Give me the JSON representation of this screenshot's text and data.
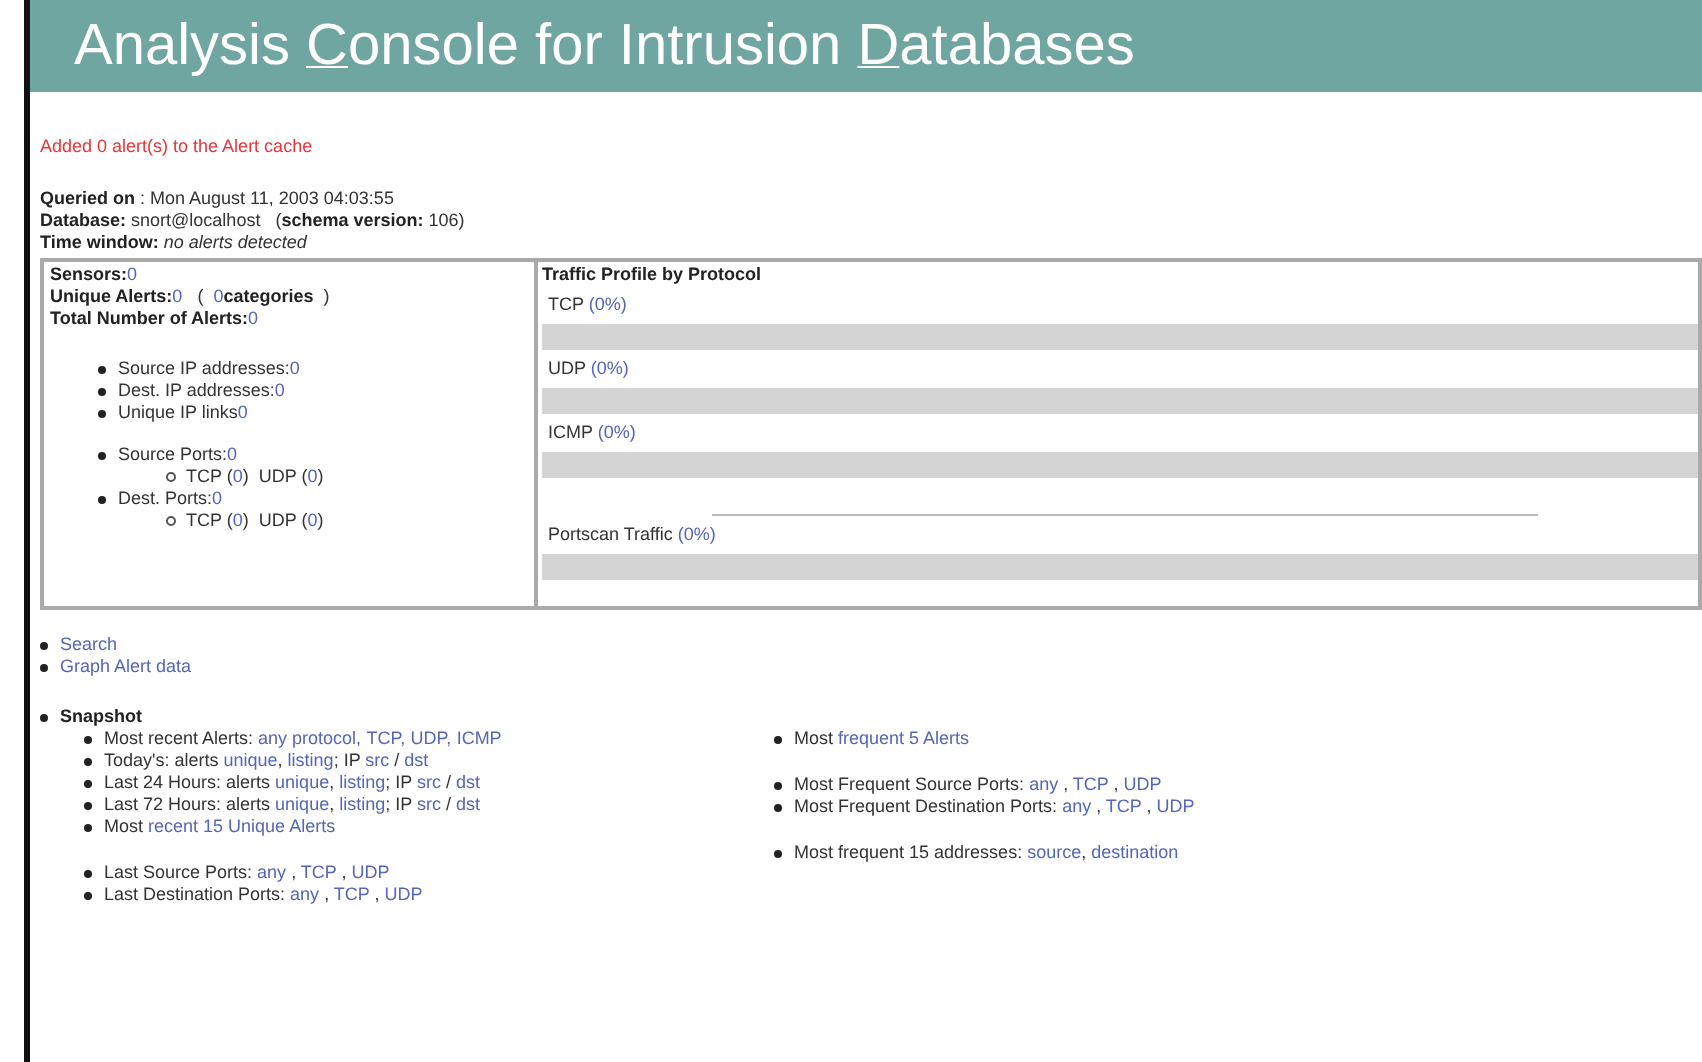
{
  "title": [
    {
      "text": "Analysis ",
      "underline": false
    },
    {
      "text": "C",
      "underline": true
    },
    {
      "text": "onsole for Intrusion ",
      "underline": false
    },
    {
      "text": "D",
      "underline": true
    },
    {
      "text": "atabases",
      "underline": false
    }
  ],
  "alert_message": "Added 0 alert(s) to the Alert cache",
  "query_info": [
    [
      {
        "kind": "bold",
        "text": "Queried on"
      },
      {
        "kind": "text",
        "text": " : Mon August 11, 2003 04:03:55"
      }
    ],
    [
      {
        "kind": "bold",
        "text": "Database:"
      },
      {
        "kind": "text",
        "text": " snort@localhost   ("
      },
      {
        "kind": "bold",
        "text": "schema version:"
      },
      {
        "kind": "text",
        "text": " 106)"
      }
    ],
    [
      {
        "kind": "bold",
        "text": "Time window:"
      },
      {
        "kind": "italic",
        "text": " no alerts detected"
      }
    ]
  ],
  "summary": [
    [
      {
        "kind": "bold",
        "text": "Sensors:"
      },
      {
        "kind": "link",
        "text": "0"
      }
    ],
    [
      {
        "kind": "bold",
        "text": "Unique Alerts:"
      },
      {
        "kind": "link",
        "text": "0"
      },
      {
        "kind": "text",
        "text": "   (  "
      },
      {
        "kind": "link",
        "text": "0"
      },
      {
        "kind": "bold",
        "text": "categories"
      },
      {
        "kind": "text",
        "text": "  )"
      }
    ],
    [
      {
        "kind": "bold",
        "text": "Total Number of Alerts:"
      },
      {
        "kind": "link",
        "text": "0"
      }
    ]
  ],
  "summary_lists": [
    [
      {
        "segments": [
          {
            "kind": "text",
            "text": "Source IP addresses:"
          },
          {
            "kind": "link",
            "text": "0"
          }
        ]
      },
      {
        "segments": [
          {
            "kind": "text",
            "text": "Dest. IP addresses:"
          },
          {
            "kind": "link",
            "text": "0"
          }
        ]
      },
      {
        "segments": [
          {
            "kind": "text",
            "text": "Unique IP links"
          },
          {
            "kind": "link",
            "text": "0"
          }
        ]
      }
    ],
    [
      {
        "segments": [
          {
            "kind": "text",
            "text": "Source Ports:"
          },
          {
            "kind": "link",
            "text": "0"
          }
        ],
        "children": [
          [
            {
              "kind": "text",
              "text": "TCP ("
            },
            {
              "kind": "link",
              "text": "0"
            },
            {
              "kind": "text",
              "text": ")  UDP ("
            },
            {
              "kind": "link",
              "text": "0"
            },
            {
              "kind": "text",
              "text": ")"
            }
          ]
        ]
      },
      {
        "segments": [
          {
            "kind": "text",
            "text": "Dest. Ports:"
          },
          {
            "kind": "link",
            "text": "0"
          }
        ],
        "children": [
          [
            {
              "kind": "text",
              "text": "TCP ("
            },
            {
              "kind": "link",
              "text": "0"
            },
            {
              "kind": "text",
              "text": ")  UDP ("
            },
            {
              "kind": "link",
              "text": "0"
            },
            {
              "kind": "text",
              "text": ")"
            }
          ]
        ]
      }
    ]
  ],
  "traffic": {
    "heading": "Traffic Profile by Protocol",
    "protocols": [
      {
        "label": "TCP",
        "percent": "(0%)",
        "level": 0
      },
      {
        "label": "UDP",
        "percent": "(0%)",
        "level": 0
      },
      {
        "label": "ICMP",
        "percent": "(0%)",
        "level": 0
      }
    ],
    "portscan": {
      "label": "Portscan Traffic",
      "percent": "(0%)",
      "level": 0
    }
  },
  "links": [
    "Search",
    "Graph Alert data"
  ],
  "snapshot": {
    "label": "Snapshot",
    "left_groups": [
      [
        [
          {
            "kind": "text",
            "text": "Most recent Alerts: "
          },
          {
            "kind": "link",
            "text": "any protocol,"
          },
          {
            "kind": "link",
            "text": "TCP,"
          },
          {
            "kind": "link",
            "text": "UDP,"
          },
          {
            "kind": "link",
            "text": "ICMP"
          }
        ],
        [
          {
            "kind": "text",
            "text": "Today's: alerts "
          },
          {
            "kind": "link",
            "text": "unique"
          },
          {
            "kind": "text",
            "text": ", "
          },
          {
            "kind": "link",
            "text": "listing"
          },
          {
            "kind": "text",
            "text": "; IP "
          },
          {
            "kind": "link",
            "text": "src"
          },
          {
            "kind": "text",
            "text": " / "
          },
          {
            "kind": "link",
            "text": "dst"
          }
        ],
        [
          {
            "kind": "text",
            "text": "Last 24 Hours: alerts "
          },
          {
            "kind": "link",
            "text": "unique"
          },
          {
            "kind": "text",
            "text": ", "
          },
          {
            "kind": "link",
            "text": "listing"
          },
          {
            "kind": "text",
            "text": "; IP "
          },
          {
            "kind": "link",
            "text": "src"
          },
          {
            "kind": "text",
            "text": " / "
          },
          {
            "kind": "link",
            "text": "dst"
          }
        ],
        [
          {
            "kind": "text",
            "text": "Last 72 Hours: alerts "
          },
          {
            "kind": "link",
            "text": "unique"
          },
          {
            "kind": "text",
            "text": ", "
          },
          {
            "kind": "link",
            "text": "listing"
          },
          {
            "kind": "text",
            "text": "; IP "
          },
          {
            "kind": "link",
            "text": "src"
          },
          {
            "kind": "text",
            "text": " / "
          },
          {
            "kind": "link",
            "text": "dst"
          }
        ],
        [
          {
            "kind": "text",
            "text": "Most "
          },
          {
            "kind": "link",
            "text": "recent 15 Unique Alerts"
          }
        ]
      ],
      [
        [
          {
            "kind": "text",
            "text": "Last Source Ports: "
          },
          {
            "kind": "link",
            "text": "any"
          },
          {
            "kind": "text",
            "text": " , "
          },
          {
            "kind": "link",
            "text": "TCP"
          },
          {
            "kind": "text",
            "text": " , "
          },
          {
            "kind": "link",
            "text": "UDP"
          }
        ],
        [
          {
            "kind": "text",
            "text": "Last Destination Ports: "
          },
          {
            "kind": "link",
            "text": "any"
          },
          {
            "kind": "text",
            "text": " , "
          },
          {
            "kind": "link",
            "text": "TCP"
          },
          {
            "kind": "text",
            "text": " , "
          },
          {
            "kind": "link",
            "text": "UDP"
          }
        ]
      ]
    ],
    "right_groups": [
      [
        [
          {
            "kind": "text",
            "text": "Most "
          },
          {
            "kind": "link",
            "text": "frequent 5 Alerts"
          }
        ]
      ],
      [
        [
          {
            "kind": "text",
            "text": "Most Frequent Source Ports: "
          },
          {
            "kind": "link",
            "text": "any"
          },
          {
            "kind": "text",
            "text": " , "
          },
          {
            "kind": "link",
            "text": "TCP"
          },
          {
            "kind": "text",
            "text": " , "
          },
          {
            "kind": "link",
            "text": "UDP"
          }
        ],
        [
          {
            "kind": "text",
            "text": "Most Frequent Destination Ports: "
          },
          {
            "kind": "link",
            "text": "any"
          },
          {
            "kind": "text",
            "text": " , "
          },
          {
            "kind": "link",
            "text": "TCP"
          },
          {
            "kind": "text",
            "text": " , "
          },
          {
            "kind": "link",
            "text": "UDP"
          }
        ]
      ],
      [
        [
          {
            "kind": "text",
            "text": "Most frequent 15 addresses: "
          },
          {
            "kind": "link",
            "text": "source"
          },
          {
            "kind": "text",
            "text": ", "
          },
          {
            "kind": "link",
            "text": "destination"
          }
        ]
      ]
    ]
  }
}
